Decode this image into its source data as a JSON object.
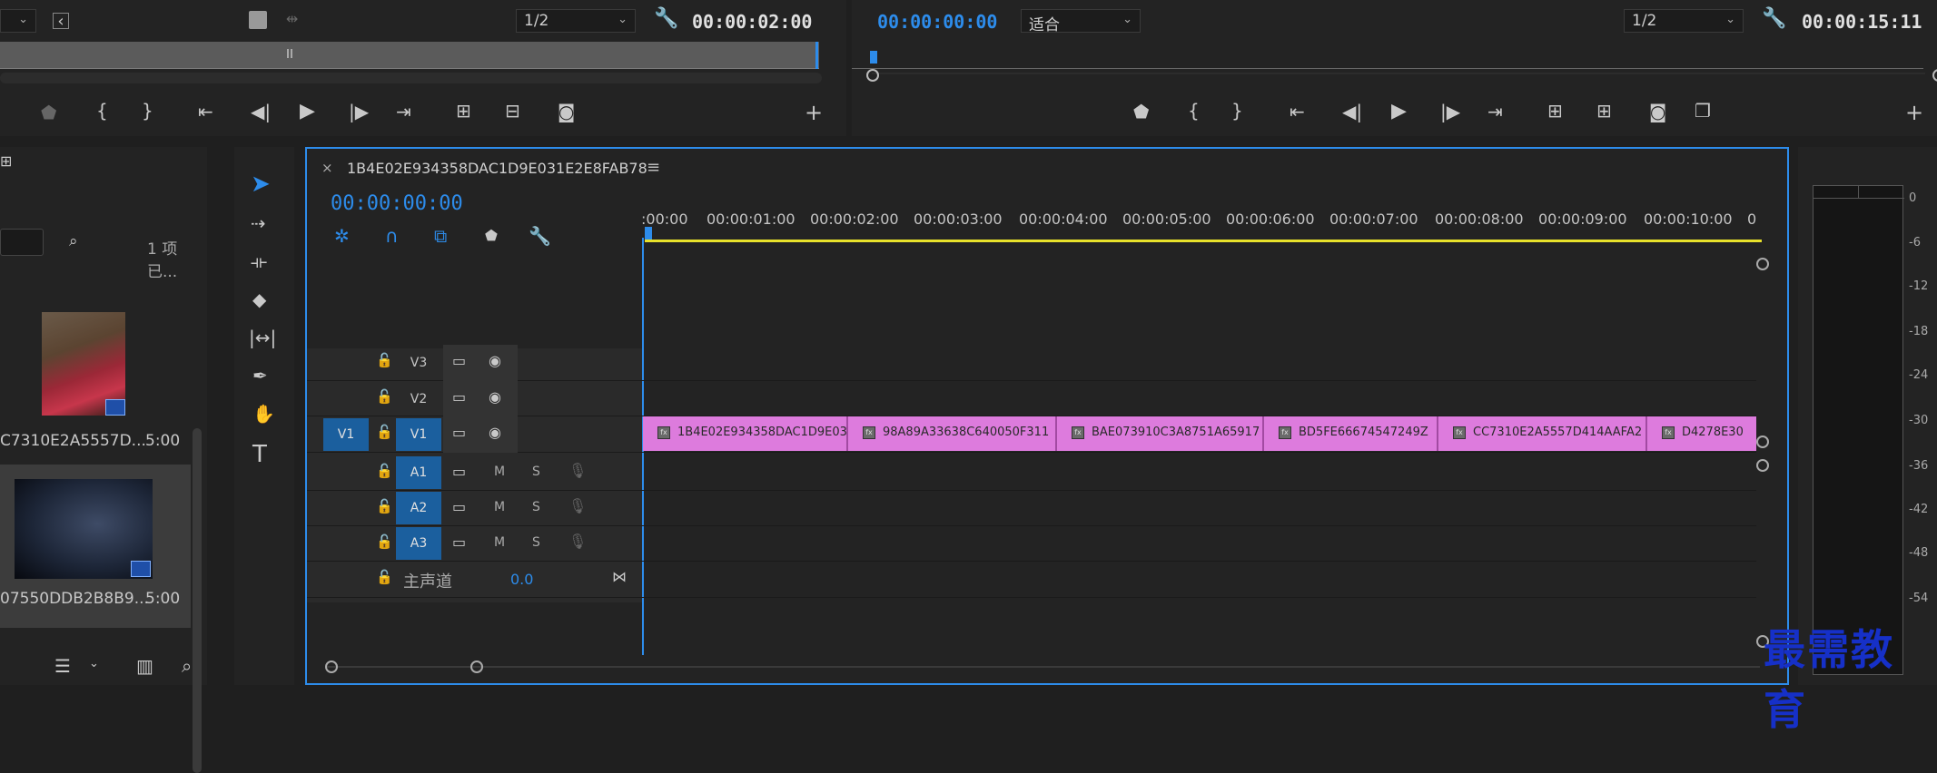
{
  "source_monitor": {
    "zoom": "1/2",
    "timecode": "00:00:02:00"
  },
  "program_monitor": {
    "timecode": "00:00:00:00",
    "fit": "适合",
    "zoom": "1/2",
    "duration": "00:00:15:11"
  },
  "project_panel": {
    "items_count": "1 项已...",
    "items": [
      {
        "name": "C7310E2A5557D...",
        "duration": "5:00"
      },
      {
        "name": "07550DDB2B8B9...",
        "duration": "5:00"
      }
    ]
  },
  "timeline": {
    "sequence_name": "1B4E02E934358DAC1D9E031E2E8FAB78",
    "close_glyph": "×",
    "menu_glyph": "≡",
    "playhead_time": "00:00:00:00",
    "ruler": [
      ":00:00",
      "00:00:01:00",
      "00:00:02:00",
      "00:00:03:00",
      "00:00:04:00",
      "00:00:05:00",
      "00:00:06:00",
      "00:00:07:00",
      "00:00:08:00",
      "00:00:09:00",
      "00:00:10:00",
      "0"
    ],
    "video_tracks": [
      {
        "name": "V3"
      },
      {
        "name": "V2"
      },
      {
        "name": "V1",
        "source_patch": "V1"
      }
    ],
    "audio_tracks": [
      {
        "name": "A1",
        "m": "M",
        "s": "S"
      },
      {
        "name": "A2",
        "m": "M",
        "s": "S"
      },
      {
        "name": "A3",
        "m": "M",
        "s": "S"
      }
    ],
    "master": {
      "label": "主声道",
      "value": "0.0"
    },
    "clips": [
      {
        "name": "1B4E02E934358DAC1D9E03"
      },
      {
        "name": "98A89A33638C640050F311"
      },
      {
        "name": "BAE073910C3A8751A65917"
      },
      {
        "name": "BD5FE66674547249Z"
      },
      {
        "name": "CC7310E2A5557D414AAFA2"
      },
      {
        "name": "D4278E30"
      }
    ]
  },
  "audio_meter": {
    "scale": [
      "0",
      "-6",
      "-12",
      "-18",
      "-24",
      "-30",
      "-36",
      "-42",
      "-48",
      "-54"
    ]
  },
  "tools": [
    "selection-tool",
    "track-select-tool",
    "ripple-edit-tool",
    "razor-tool",
    "slip-tool",
    "pen-tool",
    "hand-tool",
    "type-tool"
  ],
  "watermark": {
    "text": "最需教育"
  },
  "colors": {
    "accent_blue": "#2d8ceb",
    "clip_pink": "#dd7bdd",
    "work_area_yellow": "#e8e12b",
    "panel_bg": "#232323"
  }
}
